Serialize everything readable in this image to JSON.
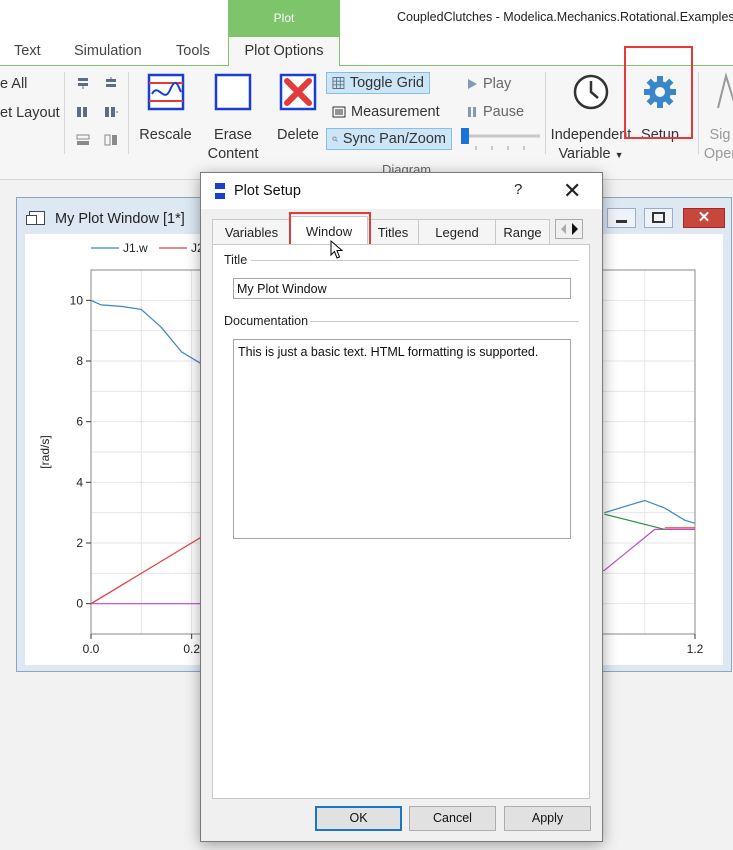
{
  "app": {
    "context_tab": "Plot",
    "window_title": "CoupledClutches - Modelica.Mechanics.Rotational.Examples.C"
  },
  "ribbon": {
    "tabs": [
      "Text",
      "Simulation",
      "Tools",
      "Plot Options"
    ],
    "left_clipped": [
      "e All",
      "et Layout"
    ],
    "buttons": {
      "rescale": "Rescale",
      "erase_content": "Erase Content",
      "delete": "Delete",
      "toggle_grid": "Toggle Grid",
      "measurement": "Measurement",
      "sync_pan_zoom": "Sync Pan/Zoom",
      "play": "Play",
      "pause": "Pause",
      "independent_variable": "Independent Variable",
      "setup": "Setup",
      "clipped_1": "Sig",
      "clipped_2": "Oper"
    },
    "group_label": "Diagram",
    "colors": {
      "context_green": "#7dc46b",
      "highlight_red": "#e53a3a",
      "gear_blue": "#3a86c8"
    }
  },
  "plot_window": {
    "title": "My Plot Window [1*]",
    "legend": [
      {
        "name": "J1.w",
        "color": "#3a86c8"
      },
      {
        "name": "J2",
        "color": "#e53a3a"
      }
    ],
    "ylabel": "[rad/s]",
    "y_ticks": [
      "10",
      "8",
      "6",
      "4",
      "2",
      "0"
    ],
    "x_ticks": [
      "0.0",
      "0.2",
      "1.2"
    ]
  },
  "chart_data": {
    "type": "line",
    "title": "",
    "xlabel": "",
    "ylabel": "[rad/s]",
    "xlim": [
      0,
      1.2
    ],
    "ylim": [
      -1,
      11
    ],
    "grid": true,
    "legend_position": "top-left",
    "series": [
      {
        "name": "J1.w",
        "color": "#3a86c8",
        "x": [
          0.0,
          0.02,
          0.06,
          0.1,
          0.14,
          0.18,
          0.22
        ],
        "y": [
          10.0,
          9.85,
          9.8,
          9.7,
          9.1,
          8.3,
          7.9
        ]
      },
      {
        "name": "J2",
        "color": "#e53a3a",
        "x": [
          0.0,
          0.22
        ],
        "y": [
          0.0,
          2.2
        ]
      },
      {
        "color": "#c04cc8",
        "x": [
          0.0,
          0.22,
          1.02,
          1.12,
          1.2
        ],
        "y": [
          0.0,
          0.0,
          1.1,
          2.45,
          2.45
        ]
      },
      {
        "color": "#3a86c8",
        "x": [
          1.02,
          1.06,
          1.1,
          1.14,
          1.18,
          1.2
        ],
        "y": [
          3.0,
          3.2,
          3.4,
          3.15,
          2.75,
          2.65
        ]
      },
      {
        "color": "#2f8f3a",
        "x": [
          1.02,
          1.14
        ],
        "y": [
          2.95,
          2.45
        ]
      },
      {
        "color": "#e53a3a",
        "x": [
          1.14,
          1.2
        ],
        "y": [
          2.5,
          2.5
        ]
      }
    ]
  },
  "dialog": {
    "title": "Plot Setup",
    "help": "?",
    "close": "✕",
    "tabs": [
      "Variables",
      "Window",
      "Titles",
      "Legend",
      "Range"
    ],
    "active_tab": "Window",
    "title_group_label": "Title",
    "title_value": "My Plot Window",
    "doc_group_label": "Documentation",
    "doc_value": "This is just a basic text. HTML formatting is supported.",
    "buttons": {
      "ok": "OK",
      "cancel": "Cancel",
      "apply": "Apply"
    }
  }
}
